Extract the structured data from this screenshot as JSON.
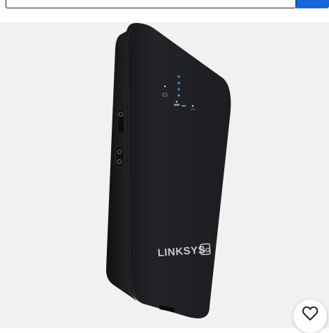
{
  "product": {
    "brand_logo_text": "LINKSYS",
    "logo_badge": "5G"
  },
  "search": {
    "value": "",
    "placeholder": ""
  },
  "icons": {
    "search_button": "search-icon",
    "wishlist": "heart-icon"
  },
  "colors": {
    "accent": "#1565d8",
    "gallery_background": "#f1f1f1",
    "device_body": "#1e1f22",
    "led": "#3aa0ff"
  }
}
